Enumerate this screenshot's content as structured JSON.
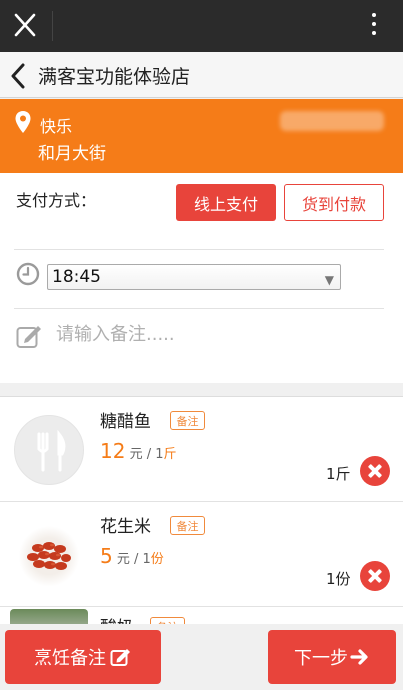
{
  "window": {
    "close_icon": "close-icon",
    "menu_icon": "more-vertical-icon"
  },
  "header": {
    "back_icon": "chevron-left-icon",
    "title": "满客宝功能体验店"
  },
  "address": {
    "icon": "location-pin-icon",
    "name": "快乐",
    "street": "和月大街",
    "color": "#f57c18"
  },
  "payment": {
    "label": "支付方式：",
    "online_label": "线上支付",
    "cod_label": "货到付款",
    "selected": "线上支付",
    "accent": "#e8443b"
  },
  "time": {
    "icon": "clock-icon",
    "value": "18:45"
  },
  "remark": {
    "icon": "edit-icon",
    "placeholder": "请输入备注....."
  },
  "items": [
    {
      "name": "糖醋鱼",
      "tag": "备注",
      "price": "12",
      "unit_text": "元 / 1",
      "unit": "斤",
      "quantity": "1斤",
      "image": "fork-knife-placeholder"
    },
    {
      "name": "花生米",
      "tag": "备注",
      "price": "5",
      "unit_text": "元 / 1",
      "unit": "份",
      "quantity": "1份",
      "image": "peanuts-photo"
    },
    {
      "name": "酸奶",
      "tag": "备注"
    }
  ],
  "footer": {
    "remark_label": "烹饪备注",
    "next_label": "下一步"
  }
}
